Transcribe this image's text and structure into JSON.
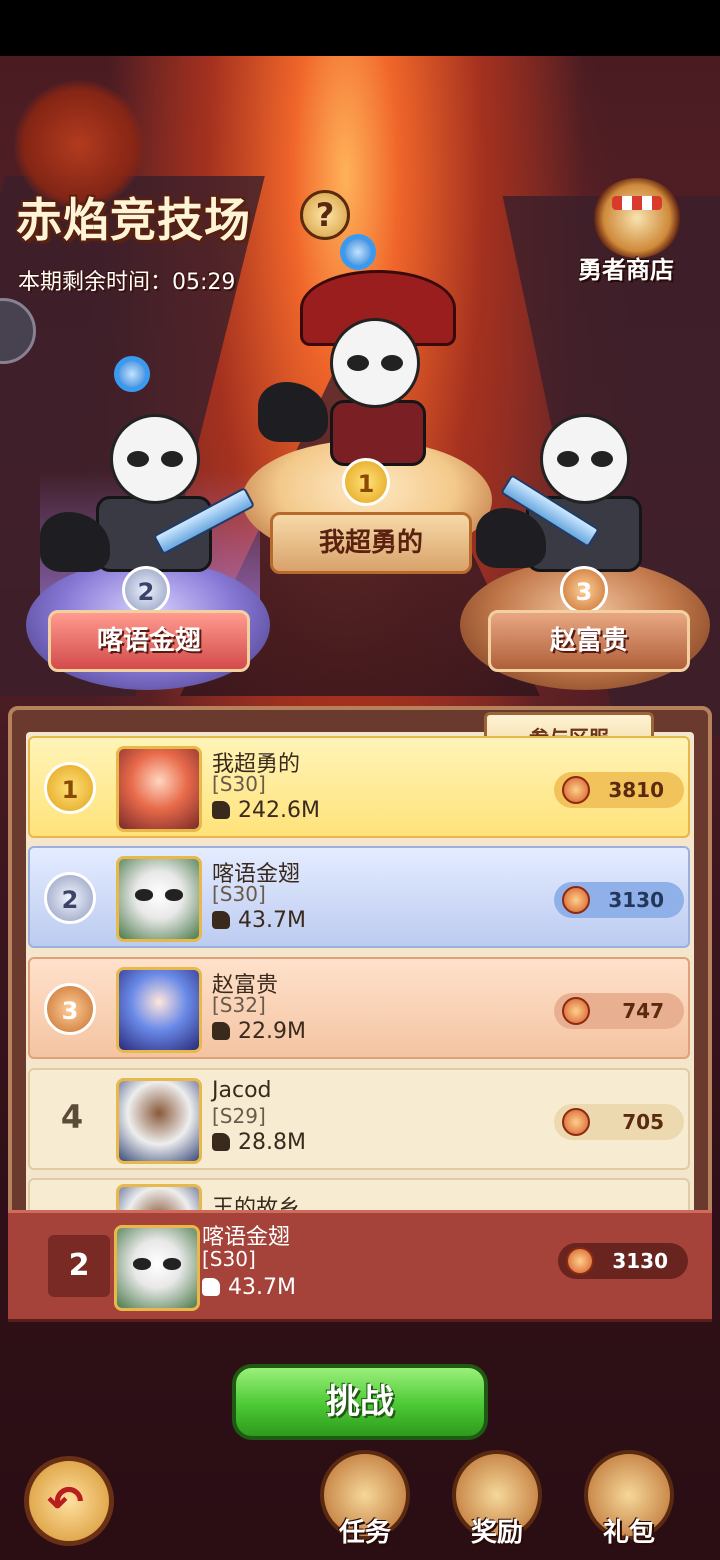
{
  "header": {
    "title": "赤焰竞技场",
    "help_glyph": "?",
    "timer_label": "本期剩余时间：05:29",
    "shop_label": "勇者商店"
  },
  "podium": [
    {
      "rank": "1",
      "name": "我超勇的"
    },
    {
      "rank": "2",
      "name": "喀语金翅"
    },
    {
      "rank": "3",
      "name": "赵富贵"
    }
  ],
  "server_tab_label": "参与区服",
  "ranking": [
    {
      "rank": "1",
      "name": "我超勇的",
      "server": "[S30]",
      "power": "242.6M",
      "score": "3810"
    },
    {
      "rank": "2",
      "name": "喀语金翅",
      "server": "[S30]",
      "power": "43.7M",
      "score": "3130"
    },
    {
      "rank": "3",
      "name": "赵富贵",
      "server": "[S32]",
      "power": "22.9M",
      "score": "747"
    },
    {
      "rank": "4",
      "name": "Jacod",
      "server": "[S29]",
      "power": "28.8M",
      "score": "705"
    },
    {
      "rank": "",
      "name": "王的故乡",
      "server": "",
      "power": "",
      "score": ""
    }
  ],
  "my_rank": {
    "rank": "2",
    "name": "喀语金翅",
    "server": "[S30]",
    "power": "43.7M",
    "score": "3130"
  },
  "challenge_label": "挑战",
  "bottom_nav": {
    "task": "任务",
    "reward": "奖励",
    "gift": "礼包"
  },
  "icons": {
    "shop": "shop-icon",
    "help": "help-icon",
    "back": "back-arrow-icon",
    "power": "fist-icon",
    "score": "trophy-icon",
    "task": "scroll-icon",
    "reward": "reward-scroll-icon",
    "gift": "gift-box-icon"
  },
  "colors": {
    "gold": "#ffe27a",
    "silver": "#bccbf0",
    "bronze": "#f4c4a2",
    "accent_green": "#4cc834",
    "panel_brown": "#6a3a2e"
  }
}
